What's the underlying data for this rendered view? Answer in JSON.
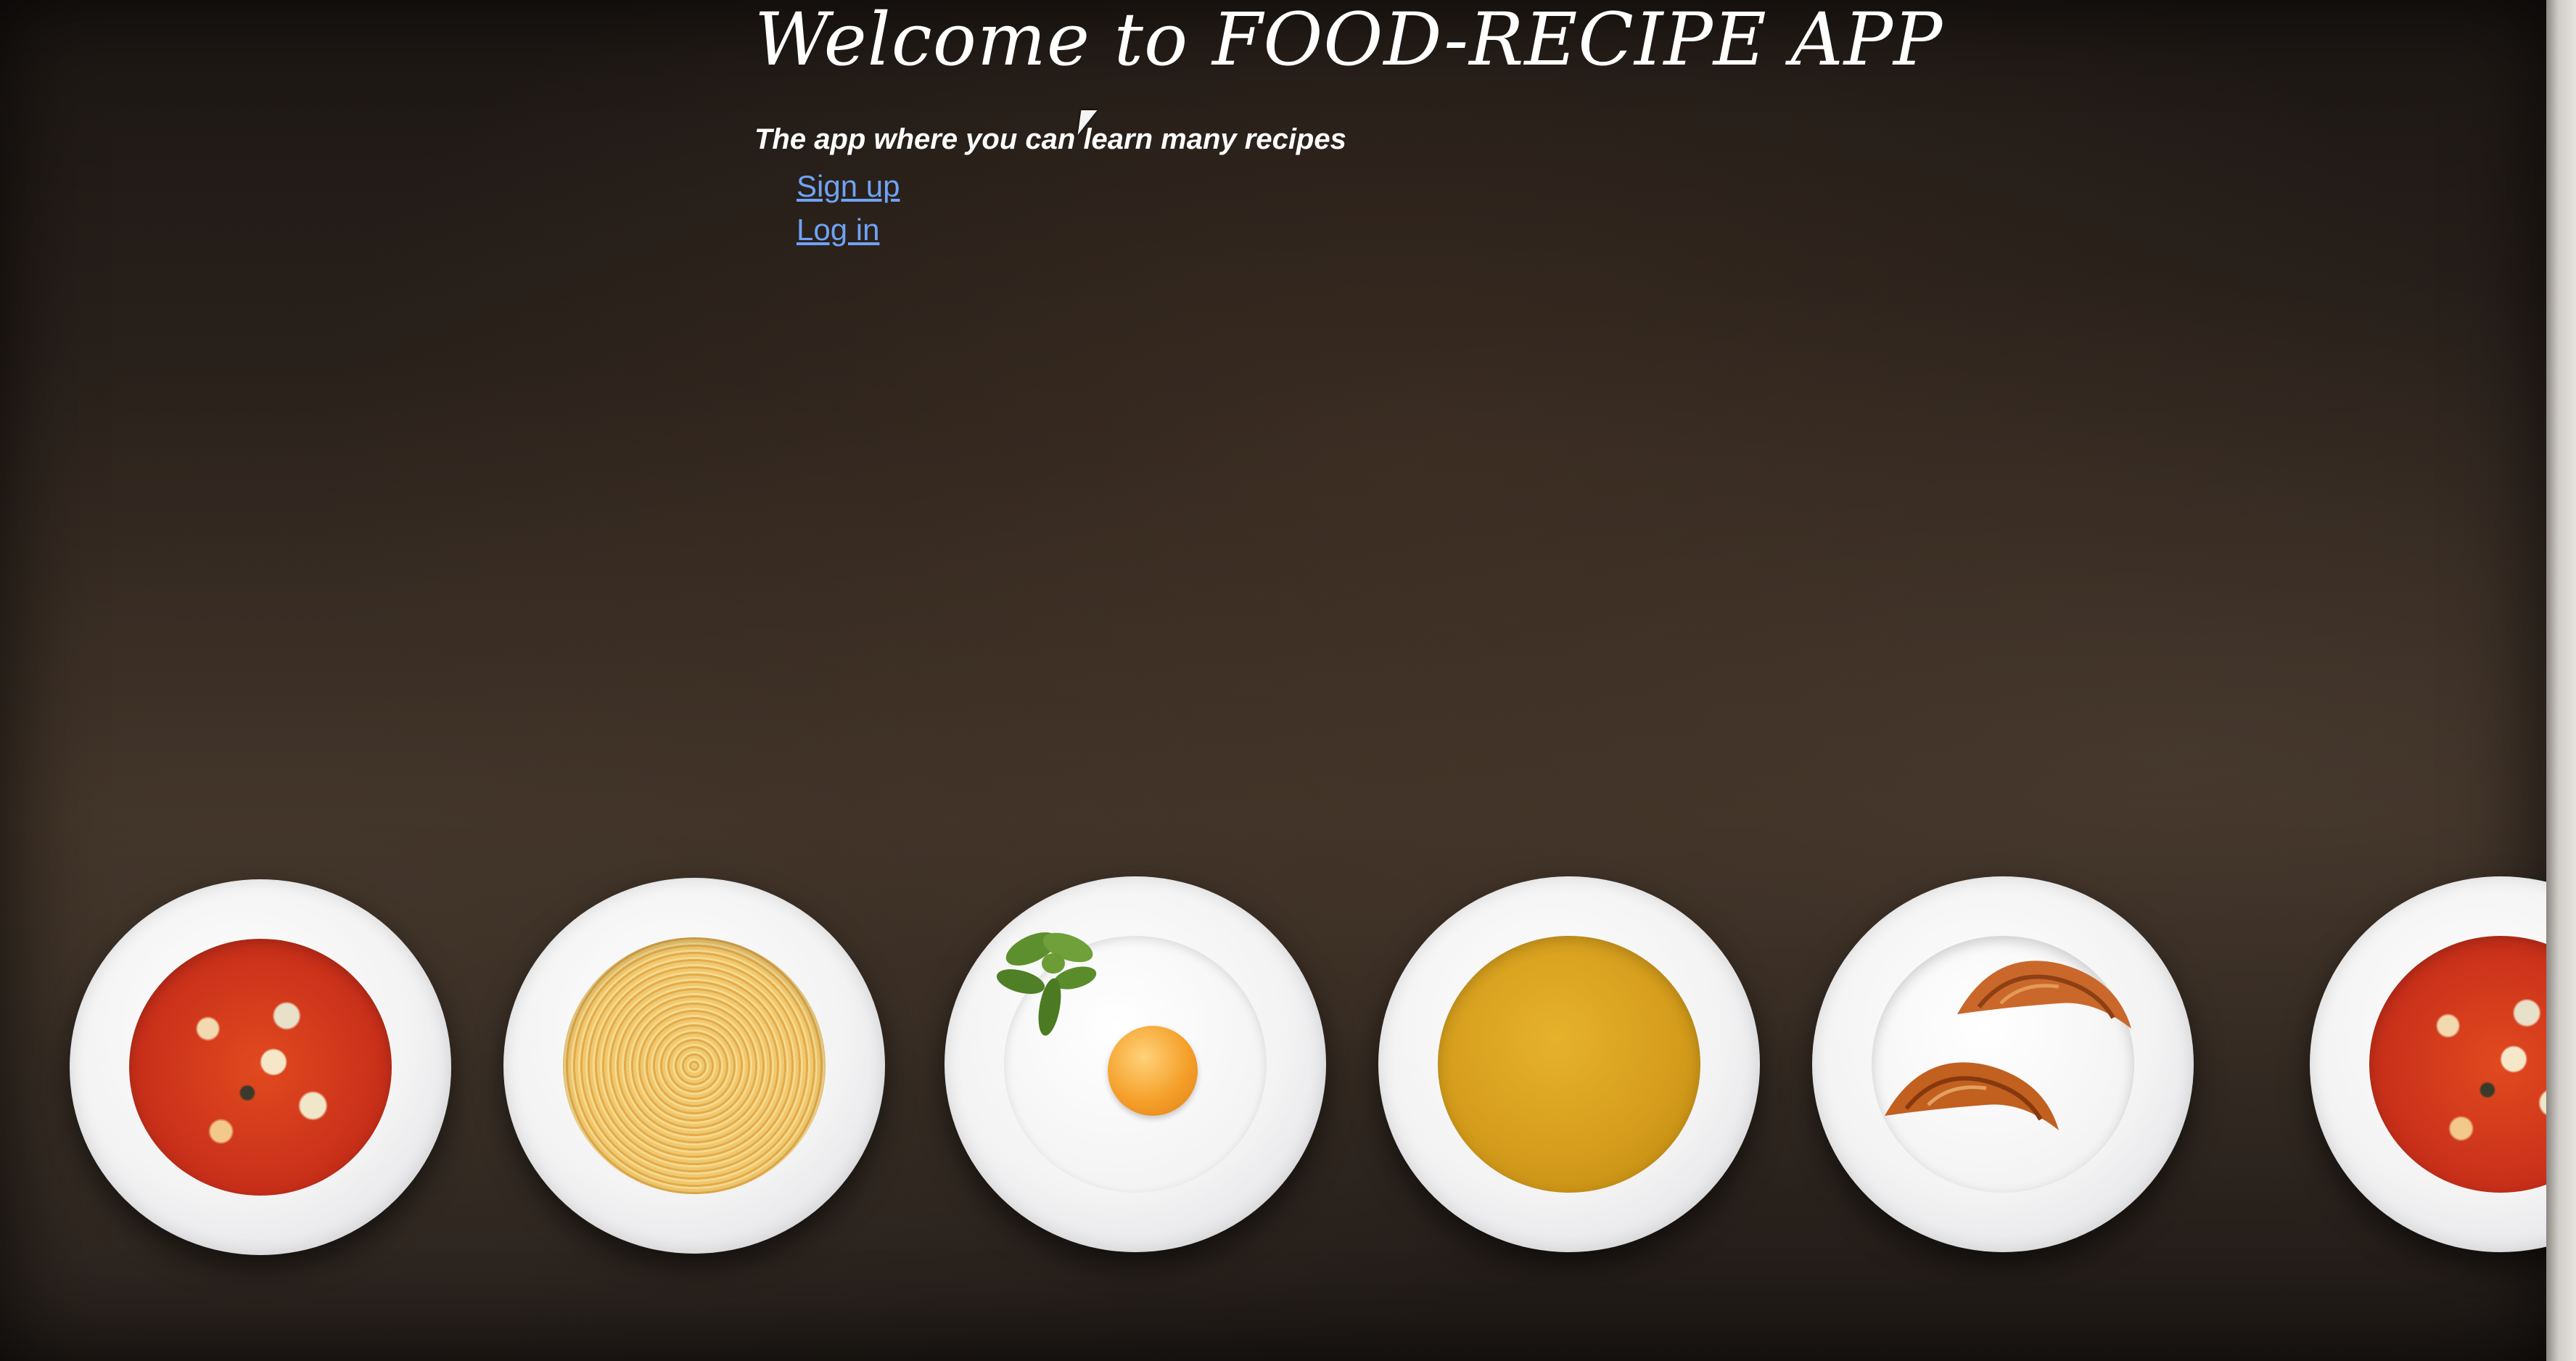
{
  "header": {
    "title": "Welcome to FOOD-RECIPE APP",
    "subtitle": "The app where you can learn many recipes"
  },
  "nav": {
    "links": [
      {
        "label": "Sign up"
      },
      {
        "label": "Log in"
      }
    ]
  },
  "colors": {
    "link": "#6ea3f5",
    "title": "#ffffff",
    "background": "#2a211b"
  },
  "plates": [
    {
      "dish": "vegetable-soup"
    },
    {
      "dish": "spaghetti"
    },
    {
      "dish": "fried-egg-with-basil"
    },
    {
      "dish": "yellow-curry"
    },
    {
      "dish": "croissants"
    },
    {
      "dish": "vegetable-soup"
    }
  ]
}
